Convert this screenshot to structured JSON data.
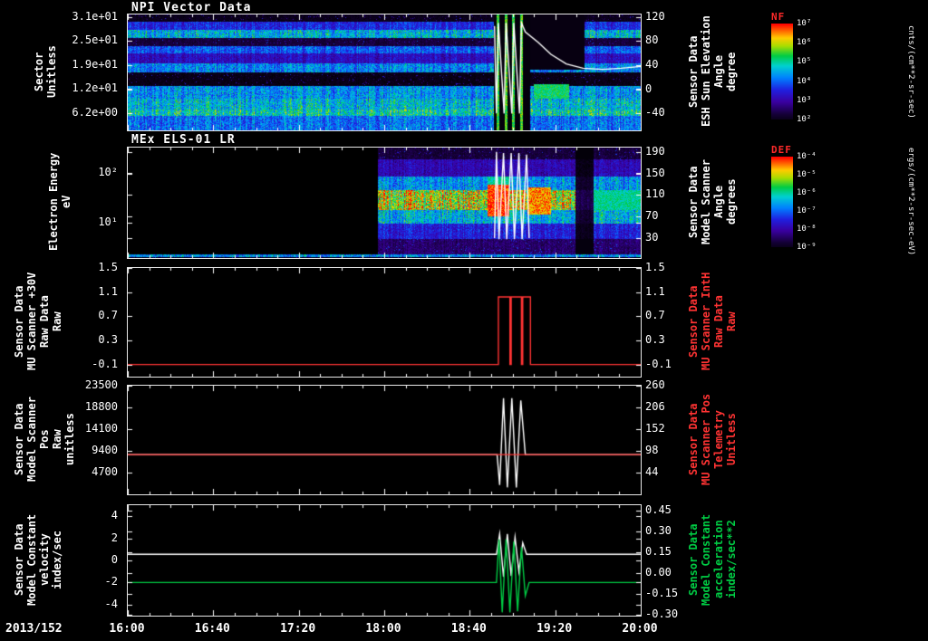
{
  "x_axis": {
    "date": "2013/152",
    "tick_labels": [
      "16:00",
      "16:40",
      "17:20",
      "18:00",
      "18:40",
      "19:20",
      "20:00"
    ],
    "range_hours": [
      0,
      4
    ]
  },
  "colors": {
    "axis_white": "#ffffff",
    "axis_red": "#ff3333",
    "axis_green": "#00cc44",
    "colorbar_title_red": "#ff2a2a"
  },
  "chart_data": [
    {
      "type": "heatmap",
      "title": "NPI Vector Data",
      "left_label": "Sector\nUnitless",
      "left_ticks": [
        "3.1e+01",
        "2.5e+01",
        "1.9e+01",
        "1.2e+01",
        "6.2e+00"
      ],
      "right_label": "Sensor Data\nESH Sun Elevation\nAngle\ndegree",
      "right_label_color": "#ffffff",
      "right_ticks": [
        "120",
        "80",
        "40",
        "0",
        "-40"
      ],
      "overlay_y_range": [
        -68,
        124
      ],
      "colorbar": {
        "title": "NF",
        "units": "cnts/(cm**2-sr-sec)",
        "ticks": [
          "10⁷",
          "10⁶",
          "10⁵",
          "10⁴",
          "10³",
          "10²"
        ]
      },
      "bands": [
        {
          "f0": 0.0,
          "f1": 0.055,
          "v": 0.05
        },
        {
          "f0": 0.055,
          "f1": 0.13,
          "v": 0.35
        },
        {
          "f0": 0.13,
          "f1": 0.2,
          "v": 0.55
        },
        {
          "f0": 0.2,
          "f1": 0.27,
          "v": 0.1
        },
        {
          "f0": 0.27,
          "f1": 0.335,
          "v": 0.42
        },
        {
          "f0": 0.335,
          "f1": 0.42,
          "v": 0.28
        },
        {
          "f0": 0.42,
          "f1": 0.5,
          "v": 0.48
        },
        {
          "f0": 0.5,
          "f1": 0.615,
          "v": 0.04
        },
        {
          "f0": 0.615,
          "f1": 0.72,
          "v": 0.5
        },
        {
          "f0": 0.72,
          "f1": 0.815,
          "v": 0.56
        },
        {
          "f0": 0.815,
          "f1": 0.875,
          "v": 0.62
        },
        {
          "f0": 0.875,
          "f1": 1.0,
          "v": 0.45
        }
      ],
      "overrides": [
        {
          "t0": 2.85,
          "t1": 3.135,
          "f0": 0,
          "f1": 1,
          "set": 0.02
        },
        {
          "t0": 2.875,
          "t1": 2.895,
          "f0": 0,
          "f1": 1,
          "set": 0.7
        },
        {
          "t0": 2.935,
          "t1": 2.955,
          "f0": 0,
          "f1": 1,
          "set": 0.72
        },
        {
          "t0": 2.995,
          "t1": 3.015,
          "f0": 0,
          "f1": 1,
          "set": 0.7
        },
        {
          "t0": 3.055,
          "t1": 3.075,
          "f0": 0,
          "f1": 1,
          "set": 0.72
        },
        {
          "t0": 3.135,
          "t1": 3.56,
          "f0": 0,
          "f1": 0.47,
          "set": 0.03
        },
        {
          "t0": 3.16,
          "t1": 3.44,
          "f0": 0.6,
          "f1": 0.72,
          "set": 0.66
        }
      ],
      "overlay_series": [
        {
          "name": "sun-elevation-angle",
          "color": "#ffffff",
          "points": [
            [
              2.86,
              105
            ],
            [
              2.875,
              -40
            ],
            [
              2.89,
              110
            ],
            [
              2.935,
              -40
            ],
            [
              2.95,
              110
            ],
            [
              2.995,
              -40
            ],
            [
              3.01,
              110
            ],
            [
              3.055,
              -40
            ],
            [
              3.07,
              110
            ],
            [
              3.1,
              95
            ],
            [
              3.2,
              78
            ],
            [
              3.3,
              58
            ],
            [
              3.42,
              42
            ],
            [
              3.55,
              35
            ],
            [
              3.7,
              33
            ],
            [
              3.85,
              35
            ],
            [
              4.0,
              38
            ]
          ]
        }
      ]
    },
    {
      "type": "heatmap",
      "title": "MEx ELS-01 LR",
      "left_label": "Electron Energy\neV",
      "left_ticks": [
        "10²",
        "10¹"
      ],
      "right_label": "Sensor Data\nModel Scanner\nAngle\ndegrees",
      "right_label_color": "#ffffff",
      "right_ticks": [
        "190",
        "150",
        "110",
        "70",
        "30"
      ],
      "overlay_y_range": [
        -7,
        198
      ],
      "colorbar": {
        "title": "DEF",
        "units": "ergs/(cm**2-sr-sec-eV)",
        "ticks": [
          "10⁻⁴",
          "10⁻⁵",
          "10⁻⁶",
          "10⁻⁷",
          "10⁻⁸",
          "10⁻⁹"
        ]
      },
      "bands": [
        {
          "f0": 0.0,
          "f1": 0.1,
          "v": 0.1
        },
        {
          "f0": 0.1,
          "f1": 0.26,
          "v": 0.26
        },
        {
          "f0": 0.26,
          "f1": 0.385,
          "v": 0.5
        },
        {
          "f0": 0.385,
          "f1": 0.565,
          "v": 0.82
        },
        {
          "f0": 0.565,
          "f1": 0.685,
          "v": 0.55
        },
        {
          "f0": 0.685,
          "f1": 0.82,
          "v": 0.33
        },
        {
          "f0": 0.82,
          "f1": 0.965,
          "v": 0.16
        },
        {
          "f0": 0.965,
          "f1": 0.985,
          "v": 0.5
        },
        {
          "f0": 0.985,
          "f1": 1.0,
          "v": 0.05
        }
      ],
      "overrides": [
        {
          "t0": 0,
          "t1": 1.945,
          "f0": 0,
          "f1": 0.965,
          "set": 0
        },
        {
          "t0": 2.8,
          "t1": 2.97,
          "f0": 0.33,
          "f1": 0.62,
          "set": 0.97
        },
        {
          "t0": 2.8,
          "t1": 2.97,
          "f0": 0.26,
          "f1": 0.33,
          "set": 0.62
        },
        {
          "t0": 3.11,
          "t1": 3.3,
          "f0": 0.36,
          "f1": 0.6,
          "set": 0.9
        },
        {
          "t0": 3.49,
          "t1": 3.63,
          "f0": 0,
          "f1": 0.965,
          "mul": 0.15
        },
        {
          "t0": 3.63,
          "t1": 4.0,
          "f0": 0.385,
          "f1": 0.565,
          "set": 0.62
        }
      ],
      "overlay_series": [
        {
          "name": "scanner-angle",
          "color": "#ffffff",
          "points": [
            [
              2.86,
              30
            ],
            [
              2.875,
              190
            ],
            [
              2.895,
              28
            ],
            [
              2.93,
              188
            ],
            [
              2.955,
              28
            ],
            [
              2.99,
              188
            ],
            [
              3.015,
              28
            ],
            [
              3.05,
              188
            ],
            [
              3.075,
              28
            ],
            [
              3.11,
              185
            ],
            [
              3.13,
              30
            ]
          ]
        }
      ]
    },
    {
      "type": "line",
      "left_label": "Sensor Data\nMU Scanner +30V\nRaw Data\nRaw",
      "left_ticks": [
        "1.5",
        "1.1",
        "0.7",
        "0.3",
        "-0.1"
      ],
      "right_label": "Sensor Data\nMU Scanner IntH\nRaw Data\nRaw",
      "right_label_color": "#ff3333",
      "right_ticks": [
        "1.5",
        "1.1",
        "0.7",
        "0.3",
        "-0.1"
      ],
      "y_range": [
        -0.3,
        1.5
      ],
      "series": [
        {
          "name": "mu-scanner-30v-raw",
          "color": "#ff3333",
          "points": [
            [
              0,
              -0.1
            ],
            [
              2.89,
              -0.1
            ],
            [
              2.89,
              1.02
            ],
            [
              2.98,
              1.02
            ],
            [
              2.98,
              -0.1
            ],
            [
              2.99,
              -0.1
            ],
            [
              2.99,
              1.02
            ],
            [
              3.07,
              1.02
            ],
            [
              3.07,
              -0.1
            ],
            [
              3.08,
              -0.1
            ],
            [
              3.08,
              1.02
            ],
            [
              3.14,
              1.02
            ],
            [
              3.14,
              -0.1
            ],
            [
              4,
              -0.1
            ]
          ]
        }
      ]
    },
    {
      "type": "line",
      "left_label": "Sensor Data\nModel Scanner Pos\nRaw\nunitless",
      "left_ticks": [
        "23500",
        "18800",
        "14100",
        "9400",
        "4700"
      ],
      "right_label": "Sensor Data\nMU Scanner Pos\nTelemetry\nUnitless",
      "right_label_color": "#ff3333",
      "right_ticks": [
        "260",
        "206",
        "152",
        "98",
        "44"
      ],
      "y_range": [
        0,
        23500
      ],
      "series": [
        {
          "name": "scanner-pos-telemetry",
          "color": "#ffffff",
          "points": [
            [
              0,
              8600
            ],
            [
              2.88,
              8600
            ],
            [
              2.9,
              2000
            ],
            [
              2.93,
              20800
            ],
            [
              2.96,
              1500
            ],
            [
              2.995,
              20800
            ],
            [
              3.03,
              1500
            ],
            [
              3.065,
              20300
            ],
            [
              3.1,
              8600
            ],
            [
              4,
              8600
            ]
          ]
        },
        {
          "name": "model-scanner-pos-raw",
          "color": "#ff3333",
          "points": [
            [
              0,
              8600
            ],
            [
              4,
              8600
            ]
          ]
        }
      ]
    },
    {
      "type": "line",
      "left_label": "Sensor Data\nModel Constant\nvelocity\nindex/sec",
      "left_ticks": [
        "4",
        "2",
        "0",
        "-2",
        "-4"
      ],
      "right_label": "Sensor Data\nModel Constant\nacceleration\nindex/sec**2",
      "right_label_color": "#00cc44",
      "right_ticks": [
        "0.45",
        "0.30",
        "0.15",
        "0.00",
        "-0.15",
        "-0.30"
      ],
      "y_range": [
        -5,
        5
      ],
      "series": [
        {
          "name": "model-constant-acceleration",
          "color": "#ffffff",
          "points": [
            [
              0,
              0.55
            ],
            [
              2.875,
              0.55
            ],
            [
              2.9,
              2.4
            ],
            [
              2.93,
              -1.5
            ],
            [
              2.96,
              2.4
            ],
            [
              2.99,
              -1.4
            ],
            [
              3.02,
              2.1
            ],
            [
              3.05,
              -1.0
            ],
            [
              3.08,
              1.6
            ],
            [
              3.11,
              0.55
            ],
            [
              4,
              0.55
            ]
          ]
        },
        {
          "name": "model-constant-velocity",
          "color": "#00cc44",
          "points": [
            [
              0,
              -2
            ],
            [
              2.875,
              -2
            ],
            [
              2.895,
              1.9
            ],
            [
              2.92,
              -4.7
            ],
            [
              2.95,
              1.9
            ],
            [
              2.98,
              -4.7
            ],
            [
              3.01,
              1.7
            ],
            [
              3.04,
              -4.6
            ],
            [
              3.07,
              1.2
            ],
            [
              3.1,
              -3.2
            ],
            [
              3.13,
              -2
            ],
            [
              4,
              -2
            ]
          ]
        }
      ]
    }
  ]
}
